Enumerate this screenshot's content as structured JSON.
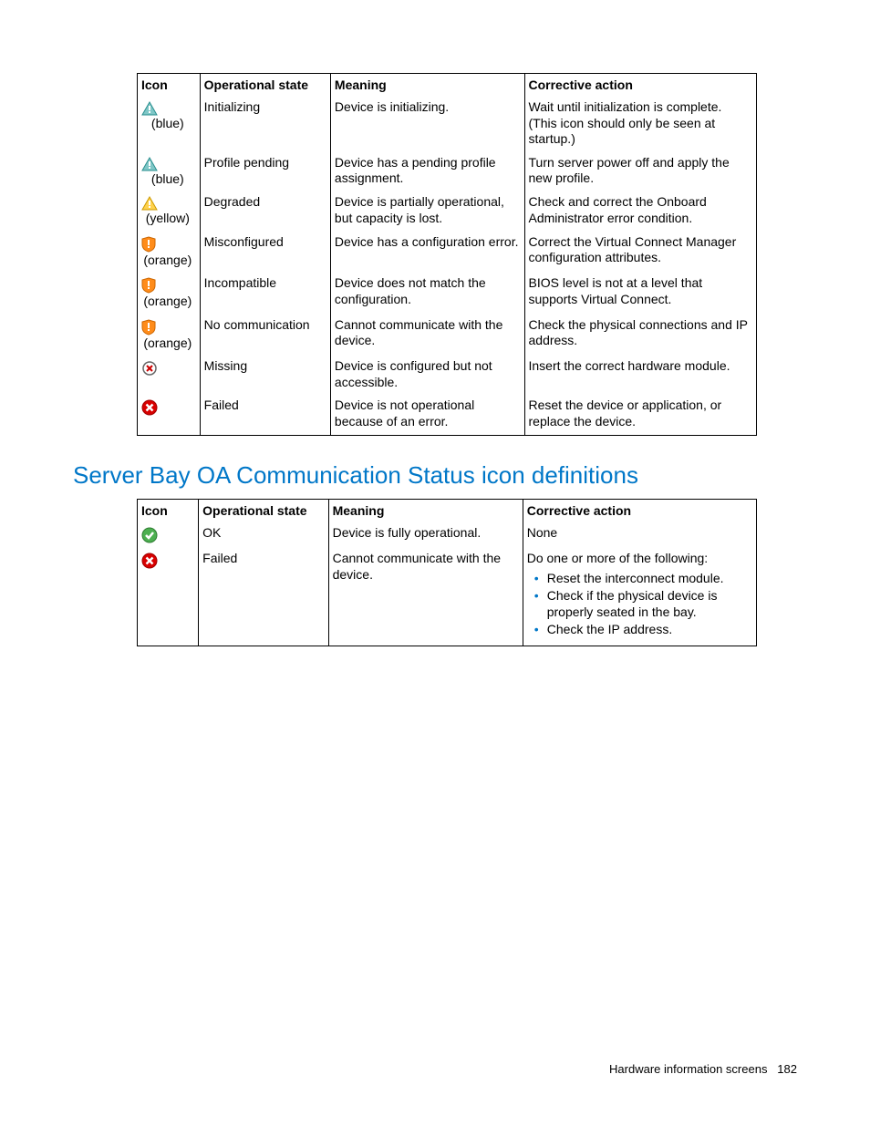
{
  "tables": {
    "t1": {
      "headers": {
        "icon": "Icon",
        "state": "Operational state",
        "meaning": "Meaning",
        "action": "Corrective action"
      },
      "rows": [
        {
          "icon_label": "(blue)",
          "state": "Initializing",
          "meaning": "Device is initializing.",
          "action": "Wait until initialization is complete. (This icon should only be seen at startup.)"
        },
        {
          "icon_label": "(blue)",
          "state": "Profile pending",
          "meaning": "Device has a pending profile assignment.",
          "action": "Turn server power off and apply the new profile."
        },
        {
          "icon_label": "(yellow)",
          "state": "Degraded",
          "meaning": "Device is partially operational, but capacity is lost.",
          "action": "Check and correct the Onboard Administrator error condition."
        },
        {
          "icon_label": "(orange)",
          "state": "Misconfigured",
          "meaning": "Device has a configuration error.",
          "action": "Correct the Virtual Connect Manager configuration attributes."
        },
        {
          "icon_label": "(orange)",
          "state": "Incompatible",
          "meaning": "Device does not match the configuration.",
          "action": "BIOS level is not at a level that supports Virtual Connect."
        },
        {
          "icon_label": "(orange)",
          "state": "No communication",
          "meaning": "Cannot communicate with the device.",
          "action": "Check the physical connections and IP address."
        },
        {
          "icon_label": "",
          "state": "Missing",
          "meaning": "Device is configured but not accessible.",
          "action": "Insert the correct hardware module."
        },
        {
          "icon_label": "",
          "state": "Failed",
          "meaning": "Device is not operational because of an error.",
          "action": "Reset the device or application, or replace the device."
        }
      ]
    },
    "t2": {
      "heading": "Server Bay OA Communication Status icon definitions",
      "headers": {
        "icon": "Icon",
        "state": "Operational state",
        "meaning": "Meaning",
        "action": "Corrective action"
      },
      "rows": [
        {
          "state": "OK",
          "meaning": "Device is fully operational.",
          "action": "None"
        },
        {
          "state": "Failed",
          "meaning": "Cannot communicate with the device.",
          "action_intro": "Do one or more of the following:",
          "action_list": [
            "Reset the interconnect module.",
            "Check if the physical device is properly seated in the bay.",
            "Check the IP address."
          ]
        }
      ]
    }
  },
  "footer": {
    "section": "Hardware information screens",
    "page": "182"
  }
}
